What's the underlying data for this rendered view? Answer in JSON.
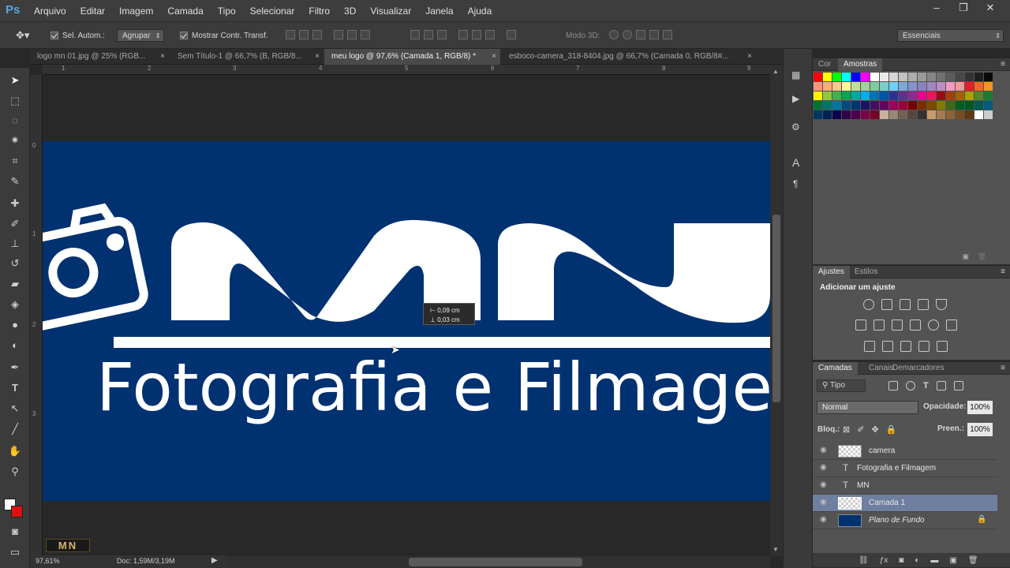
{
  "app": {
    "logo": "Ps"
  },
  "menu": [
    "Arquivo",
    "Editar",
    "Imagem",
    "Camada",
    "Tipo",
    "Selecionar",
    "Filtro",
    "3D",
    "Visualizar",
    "Janela",
    "Ajuda"
  ],
  "window_controls": [
    "–",
    "❐",
    "✕"
  ],
  "options": {
    "auto_select_label": "Sel. Autom.:",
    "group_value": "Agrupar",
    "show_transform_label": "Mostrar Contr. Transf.",
    "mode_3d_label": "Modo 3D:",
    "workspace_value": "Essenciais"
  },
  "tabs": [
    {
      "label": "logo mn 01.jpg @ 25% (RGB...",
      "close": "×"
    },
    {
      "label": "Sem Título-1 @ 66,7% (B, RGB/8...",
      "close": "×"
    },
    {
      "label": "meu logo @ 97,6% (Camada 1, RGB/8) *",
      "close": "×"
    },
    {
      "label": "esboco-camera_318-8404.jpg @ 66,7% (Camada 0, RGB/8#...",
      "close": "×"
    }
  ],
  "ruler": {
    "top": [
      "1",
      "2",
      "3",
      "4",
      "5",
      "6",
      "7",
      "8",
      "9"
    ],
    "left": [
      "0",
      "1",
      "2",
      "3"
    ]
  },
  "canvas": {
    "logo_text": "MN",
    "tagline": "Fotografia e Filmagem",
    "tooltip_w": "0,09 cm",
    "tooltip_h": "0,03 cm",
    "colors": {
      "background": "#003171",
      "foreground": "#ffffff"
    }
  },
  "status": {
    "zoom": "97,61%",
    "doc": "Doc: 1,59M/3,19M"
  },
  "watermark": "MN",
  "swatches_panel": {
    "tabs": [
      "Cor",
      "Amostras"
    ]
  },
  "adjustments_panel": {
    "tabs": [
      "Ajustes",
      "Estilos"
    ],
    "heading": "Adicionar um ajuste"
  },
  "layers_panel": {
    "tabs": [
      "Camadas",
      "Canais",
      "Demarcadores"
    ],
    "filter_kind": "Tipo",
    "blend_mode": "Normal",
    "opacity_label": "Opacidade:",
    "opacity_value": "100%",
    "lock_label": "Bloq.:",
    "fill_label": "Preen.:",
    "fill_value": "100%",
    "layers": [
      {
        "name": "camera",
        "kind": "pixel"
      },
      {
        "name": "Fotografia e Filmagem",
        "kind": "text"
      },
      {
        "name": "MN",
        "kind": "text"
      },
      {
        "name": "Camada 1",
        "kind": "pixel",
        "selected": true
      },
      {
        "name": "Plano de Fundo",
        "kind": "background",
        "locked": true
      }
    ]
  }
}
